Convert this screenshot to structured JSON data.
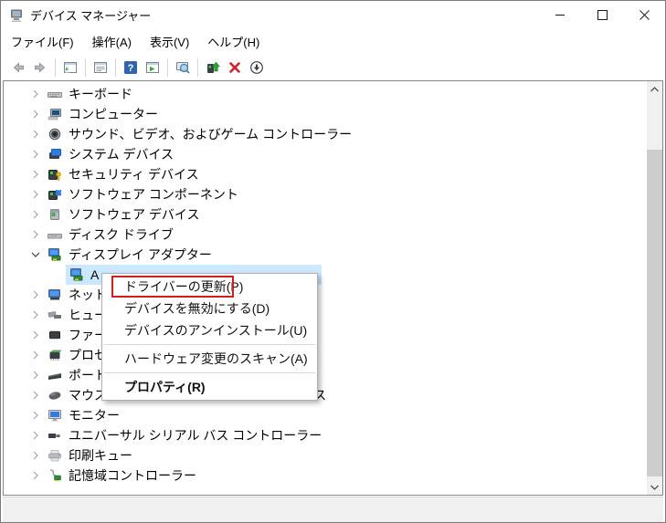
{
  "window": {
    "title": "デバイス マネージャー",
    "controls": [
      "minimize",
      "maximize",
      "close"
    ]
  },
  "menubar": {
    "items": [
      "ファイル(F)",
      "操作(A)",
      "表示(V)",
      "ヘルプ(H)"
    ]
  },
  "toolbar": {
    "buttons": [
      {
        "icon": "back-icon"
      },
      {
        "icon": "forward-icon"
      },
      {
        "sep": true
      },
      {
        "icon": "show-console-tree-icon"
      },
      {
        "sep": true
      },
      {
        "icon": "properties-icon"
      },
      {
        "sep": true
      },
      {
        "icon": "help-icon"
      },
      {
        "icon": "action-pane-icon"
      },
      {
        "sep": true
      },
      {
        "icon": "scan-hardware-icon"
      },
      {
        "sep": true
      },
      {
        "icon": "update-driver-icon"
      },
      {
        "icon": "uninstall-device-icon"
      },
      {
        "icon": "disable-device-icon"
      }
    ]
  },
  "tree": {
    "items": [
      {
        "label": "キーボード",
        "icon": "keyboard",
        "state": "collapsed"
      },
      {
        "label": "コンピューター",
        "icon": "computer",
        "state": "collapsed"
      },
      {
        "label": "サウンド、ビデオ、およびゲーム コントローラー",
        "icon": "sound",
        "state": "collapsed"
      },
      {
        "label": "システム デバイス",
        "icon": "system-device",
        "state": "collapsed"
      },
      {
        "label": "セキュリティ デバイス",
        "icon": "security-device",
        "state": "collapsed"
      },
      {
        "label": "ソフトウェア コンポーネント",
        "icon": "software-component",
        "state": "collapsed"
      },
      {
        "label": "ソフトウェア デバイス",
        "icon": "software-device",
        "state": "collapsed"
      },
      {
        "label": "ディスク ドライブ",
        "icon": "disk-drive",
        "state": "collapsed"
      },
      {
        "label": "ディスプレイ アダプター",
        "icon": "display-adapter",
        "state": "expanded"
      },
      {
        "label": "A",
        "icon": "display-adapter",
        "child": true,
        "selected": true
      },
      {
        "label": "ネット",
        "icon": "network-adapter",
        "state": "collapsed"
      },
      {
        "label": "ヒュー",
        "icon": "hid",
        "state": "collapsed"
      },
      {
        "label": "ファー",
        "icon": "firmware",
        "state": "collapsed"
      },
      {
        "label": "プロセ",
        "icon": "processor",
        "state": "collapsed"
      },
      {
        "label": "ポート",
        "icon": "port",
        "state": "collapsed"
      },
      {
        "label": "マウスとそのほかのポインティング デバイス",
        "icon": "mouse",
        "state": "collapsed"
      },
      {
        "label": "モニター",
        "icon": "monitor",
        "state": "collapsed"
      },
      {
        "label": "ユニバーサル シリアル バス コントローラー",
        "icon": "usb",
        "state": "collapsed"
      },
      {
        "label": "印刷キュー",
        "icon": "print-queue",
        "state": "collapsed"
      },
      {
        "label": "記憶域コントローラー",
        "icon": "storage-controller",
        "state": "collapsed"
      }
    ]
  },
  "context_menu": {
    "items": [
      {
        "label": "ドライバーの更新(P)",
        "annotated": true
      },
      {
        "label": "デバイスを無効にする(D)"
      },
      {
        "label": "デバイスのアンインストール(U)"
      },
      {
        "separator": true
      },
      {
        "label": "ハードウェア変更のスキャン(A)"
      },
      {
        "separator": true
      },
      {
        "label": "プロパティ(R)",
        "bold": true
      }
    ],
    "annotation_color": "#cf2020"
  },
  "scrollbar": {
    "up_icon": "chevron-up-icon",
    "down_icon": "chevron-down-icon"
  },
  "statusbar": {
    "text": ""
  },
  "colors": {
    "selection": "#cce8ff",
    "annotation": "#cf2020",
    "scroll_thumb": "#cdcdcd"
  }
}
